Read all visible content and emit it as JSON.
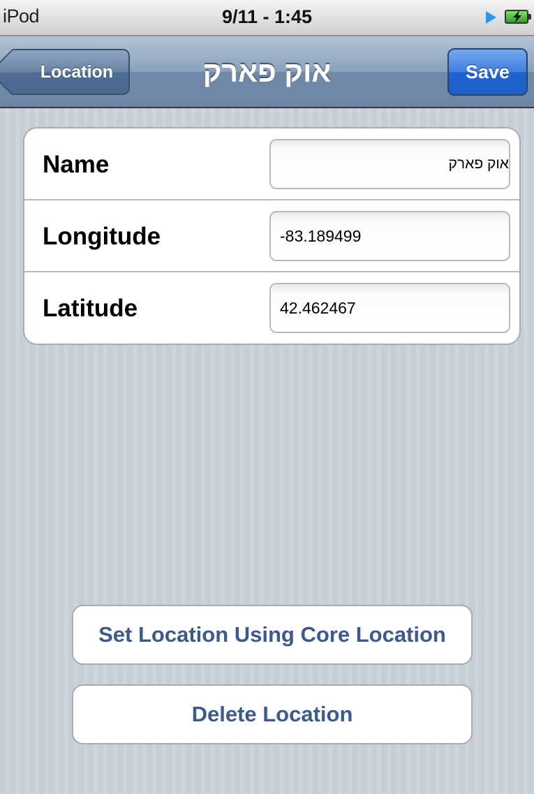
{
  "status_bar": {
    "carrier": "iPod",
    "time": "9/11 - 1:45",
    "icons": [
      "play-icon",
      "battery-charging-icon"
    ]
  },
  "nav_bar": {
    "back_label": "Location",
    "title": "אוק פארק",
    "save_label": "Save"
  },
  "form": {
    "rows": [
      {
        "label": "Name",
        "value": "אוק פארק"
      },
      {
        "label": "Longitude",
        "value": "-83.189499"
      },
      {
        "label": "Latitude",
        "value": "42.462467"
      }
    ]
  },
  "buttons": {
    "core_location": "Set Location Using Core Location",
    "delete": "Delete Location"
  },
  "colors": {
    "nav_bar": "#7f96b2",
    "save_button": "#2f6fd8",
    "button_text": "#3c5a8c",
    "background": "#c7ced7"
  }
}
